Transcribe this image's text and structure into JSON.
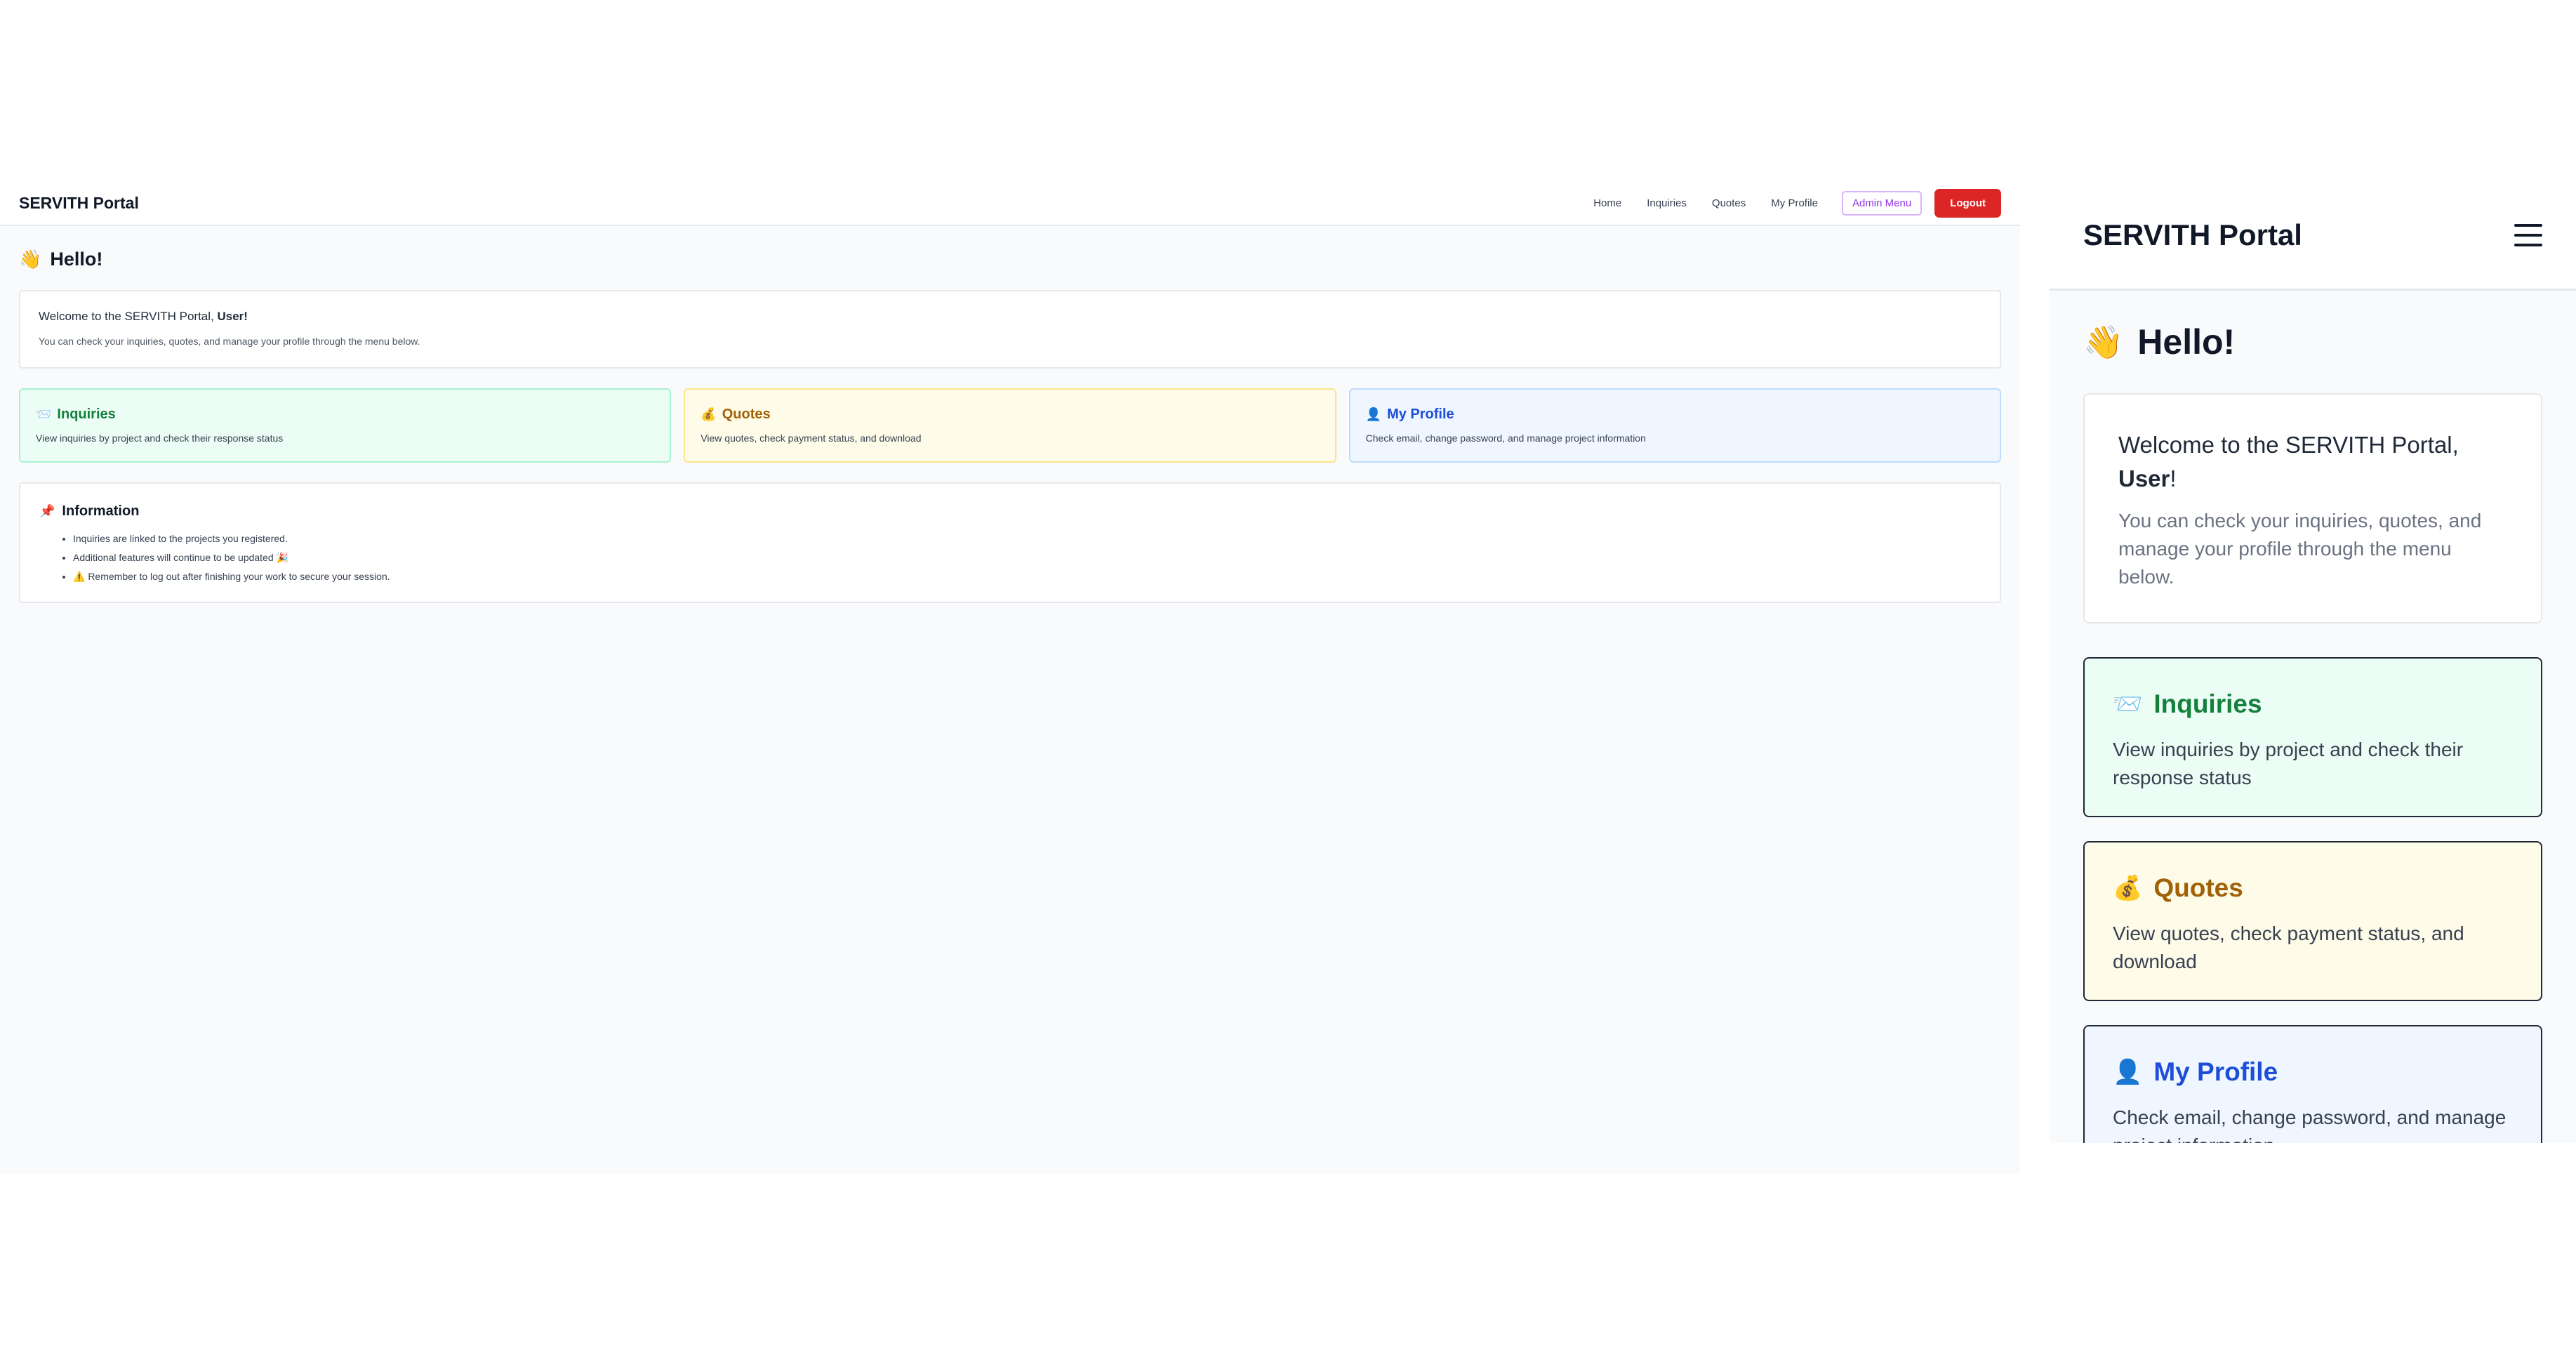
{
  "app": {
    "brand": "SERVITH Portal"
  },
  "nav": {
    "home": "Home",
    "inquiries": "Inquiries",
    "quotes": "Quotes",
    "profile": "My Profile",
    "admin": "Admin Menu",
    "logout": "Logout"
  },
  "hello": {
    "emoji": "👋",
    "text": "Hello!"
  },
  "welcome": {
    "prefix": "Welcome to the SERVITH Portal,",
    "user": "User",
    "suffix": "!",
    "sub": "You can check your inquiries, quotes, and manage your profile through the menu below."
  },
  "cards": [
    {
      "icon": "📨",
      "title": "Inquiries",
      "desc": "View inquiries by project and check their response status"
    },
    {
      "icon": "💰",
      "title": "Quotes",
      "desc": "View quotes, check payment status, and download"
    },
    {
      "icon": "👤",
      "title": "My Profile",
      "desc": "Check email, change password, and manage project information"
    }
  ],
  "info": {
    "icon": "📌",
    "title": "Information",
    "items": [
      "Inquiries are linked to the projects you registered.",
      "Additional features will continue to be updated 🎉",
      "⚠️ Remember to log out after finishing your work to secure your session."
    ]
  },
  "colors": {
    "logout": "#dc2626",
    "admin": "#9333ea",
    "inquiries": "#15803d",
    "quotes": "#a16207",
    "profile": "#1d4ed8"
  }
}
